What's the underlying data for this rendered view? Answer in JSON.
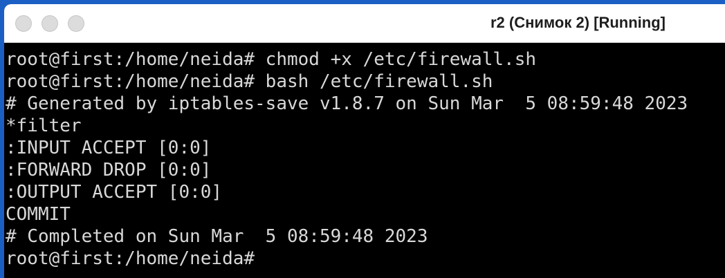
{
  "window": {
    "title": "r2 (Снимок 2) [Running]"
  },
  "terminal": {
    "lines": [
      "root@first:/home/neida# chmod +x /etc/firewall.sh",
      "root@first:/home/neida# bash /etc/firewall.sh",
      "# Generated by iptables-save v1.8.7 on Sun Mar  5 08:59:48 2023",
      "*filter",
      ":INPUT ACCEPT [0:0]",
      ":FORWARD DROP [0:0]",
      ":OUTPUT ACCEPT [0:0]",
      "COMMIT",
      "# Completed on Sun Mar  5 08:59:48 2023",
      "root@first:/home/neida#"
    ]
  }
}
